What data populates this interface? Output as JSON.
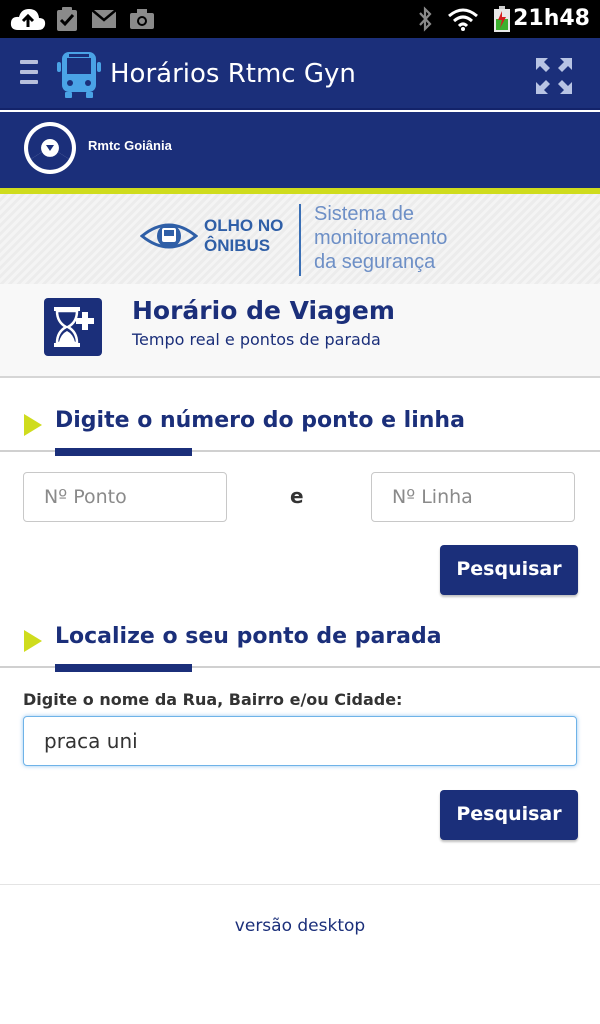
{
  "status_bar": {
    "time": "21h48",
    "icons": [
      "cloud-upload-icon",
      "clipboard-check-icon",
      "gmail-icon",
      "camera-icon",
      "bluetooth-icon",
      "wifi-icon",
      "battery-icon"
    ]
  },
  "app_bar": {
    "title": "Horários Rtmc Gyn",
    "menu_icon": "hamburger-icon",
    "logo_icon": "bus-icon",
    "action_icon": "expand-icon"
  },
  "brand": {
    "name": "Rmtc Goiânia"
  },
  "banner": {
    "logo_line1": "OLHO NO",
    "logo_line2": "ÔNIBUS",
    "text_line1": "Sistema de",
    "text_line2": "monitoramento",
    "text_line3": "da segurança"
  },
  "section": {
    "title": "Horário de Viagem",
    "subtitle": "Tempo real e pontos de parada",
    "icon": "hourglass-plus-icon"
  },
  "stop_line_search": {
    "heading": "Digite o número do ponto e linha",
    "stop_placeholder": "Nº Ponto",
    "and_label": "e",
    "line_placeholder": "Nº Linha",
    "button_label": "Pesquisar"
  },
  "locate_stop": {
    "heading": "Localize o seu ponto de parada",
    "field_label": "Digite o nome da Rua, Bairro e/ou Cidade:",
    "field_value": "praca uni",
    "button_label": "Pesquisar"
  },
  "footer": {
    "desktop_link": "versão desktop"
  },
  "colors": {
    "primary": "#1b2f7a",
    "accent": "#cfdc1d"
  }
}
